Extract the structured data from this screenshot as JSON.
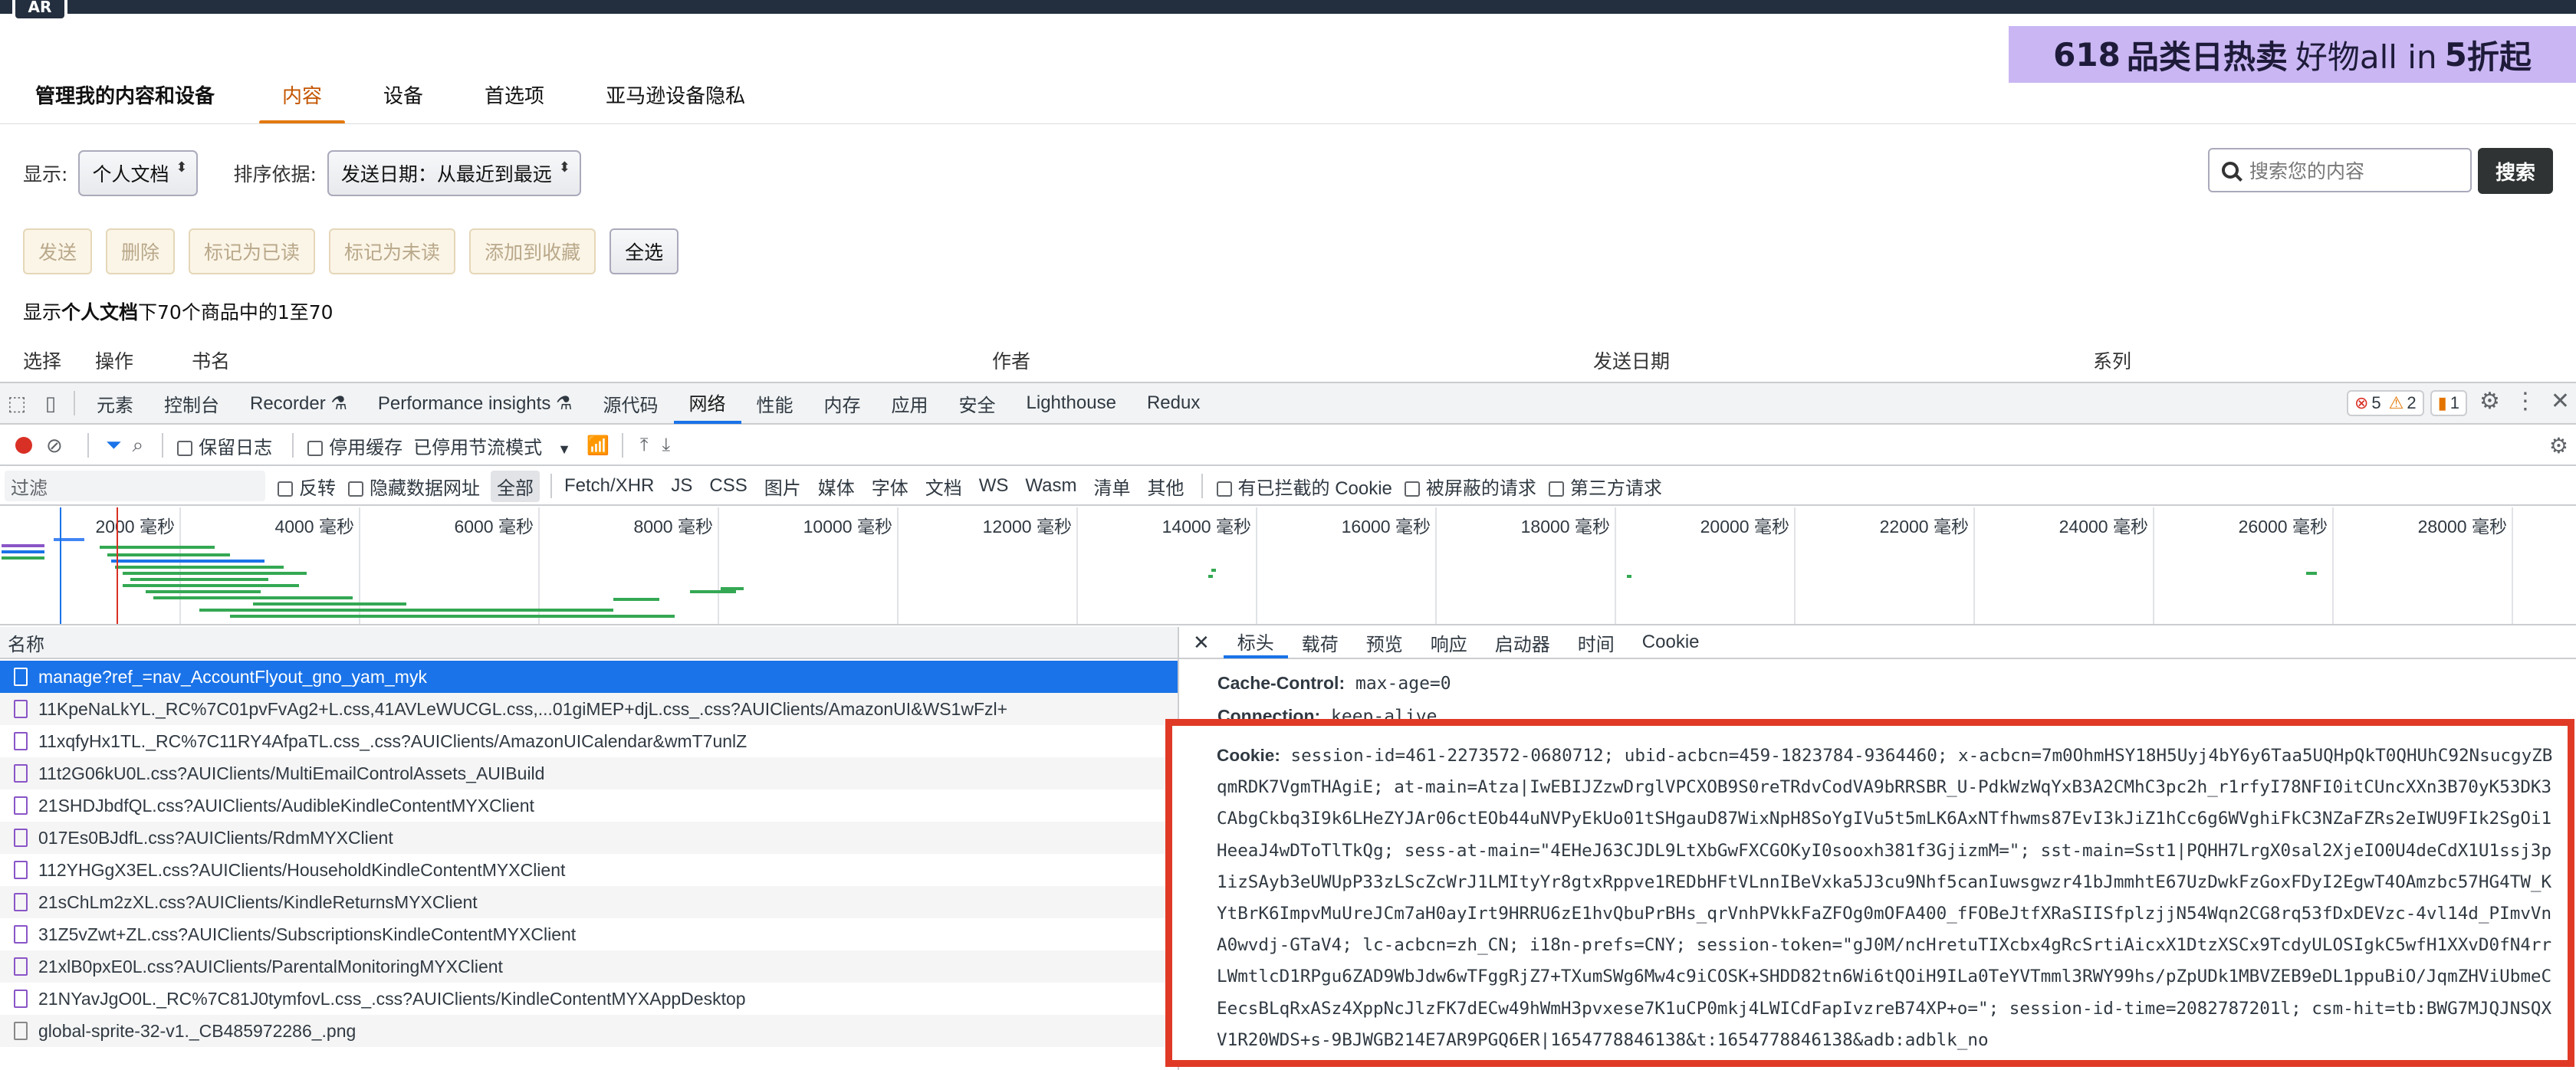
{
  "page": {
    "logo_text": "AR",
    "banner": {
      "num": "618",
      "text1": "品类日热卖",
      "text2": "好物all in",
      "num2": "5",
      "text3": "折起"
    },
    "title": "管理我的内容和设备",
    "tabs": [
      "内容",
      "设备",
      "首选项",
      "亚马逊设备隐私"
    ],
    "filter": {
      "show_label": "显示:",
      "show_value": "个人文档",
      "sort_label": "排序依据:",
      "sort_value": "发送日期：从最近到最远"
    },
    "search": {
      "placeholder": "搜索您的内容",
      "button": "搜索"
    },
    "actions": [
      "发送",
      "删除",
      "标记为已读",
      "标记为未读",
      "添加到收藏",
      "全选"
    ],
    "count": {
      "pre": "显示",
      "bold": "个人文档",
      "post": "下70个商品中的1至70"
    },
    "columns": [
      "选择",
      "操作",
      "书名",
      "作者",
      "发送日期",
      "系列"
    ]
  },
  "devtools": {
    "tabs": [
      "元素",
      "控制台",
      "Recorder ⚗",
      "Performance insights ⚗",
      "源代码",
      "网络",
      "性能",
      "内存",
      "应用",
      "安全",
      "Lighthouse",
      "Redux"
    ],
    "badges": {
      "errors": "5",
      "warnings": "2",
      "issues": "1"
    },
    "toolbar": {
      "preserve_log": "保留日志",
      "disable_cache": "停用缓存",
      "throttle": "已停用节流模式"
    },
    "filter_bar": {
      "placeholder": "过滤",
      "invert": "反转",
      "hide_data": "隐藏数据网址",
      "types": [
        "全部",
        "Fetch/XHR",
        "JS",
        "CSS",
        "图片",
        "媒体",
        "字体",
        "文档",
        "WS",
        "Wasm",
        "清单",
        "其他"
      ],
      "blocked_cookies": "有已拦截的 Cookie",
      "blocked_requests": "被屏蔽的请求",
      "third_party": "第三方请求"
    },
    "timeline_ticks": [
      "2000 毫秒",
      "4000 毫秒",
      "6000 毫秒",
      "8000 毫秒",
      "10000 毫秒",
      "12000 毫秒",
      "14000 毫秒",
      "16000 毫秒",
      "18000 毫秒",
      "20000 毫秒",
      "22000 毫秒",
      "24000 毫秒",
      "26000 毫秒",
      "28000 毫秒"
    ],
    "name_header": "名称",
    "requests": [
      "manage?ref_=nav_AccountFlyout_gno_yam_myk",
      "11KpeNaLkYL._RC%7C01pvFvAg2+L.css,41AVLeWUCGL.css,...01giMEP+djL.css_.css?AUIClients/AmazonUI&WS1wFzl+",
      "11xqfyHx1TL._RC%7C11RY4AfpaTL.css_.css?AUIClients/AmazonUICalendar&wmT7unlZ",
      "11t2G06kU0L.css?AUIClients/MultiEmailControlAssets_AUIBuild",
      "21SHDJbdfQL.css?AUIClients/AudibleKindleContentMYXClient",
      "017Es0BJdfL.css?AUIClients/RdmMYXClient",
      "112YHGgX3EL.css?AUIClients/HouseholdKindleContentMYXClient",
      "21sChLm2zXL.css?AUIClients/KindleReturnsMYXClient",
      "31Z5vZwt+ZL.css?AUIClients/SubscriptionsKindleContentMYXClient",
      "21xlB0pxE0L.css?AUIClients/ParentalMonitoringMYXClient",
      "21NYavJgO0L._RC%7C81J0tymfovL.css_.css?AUIClients/KindleContentMYXAppDesktop",
      "global-sprite-32-v1._CB485972286_.png"
    ],
    "detail_tabs": [
      "标头",
      "载荷",
      "预览",
      "响应",
      "启动器",
      "时间",
      "Cookie"
    ],
    "headers": [
      {
        "key": "Cache-Control:",
        "value": "max-age=0"
      },
      {
        "key": "Connection:",
        "value": "keep-alive"
      }
    ],
    "cookie": {
      "key": "Cookie:",
      "value": "session-id=461-2273572-0680712; ubid-acbcn=459-1823784-9364460; x-acbcn=7m0OhmHSY18H5Uyj4bY6y6Taa5UQHpQkT0QHUhC92NsucgyZBqmRDK7VgmTHAgiE; at-main=Atza|IwEBIJZzwDrglVPCXOB9S0reTRdvCodVA9bRRSBR_U-PdkWzWqYxB3A2CMhC3pc2h_r1rfyI78NFI0itCUncXXn3B70yK53DK3CAbgCkbq3I9k6LHeZYJAr06ctEOb44uNVPyEkUo01tSHgauD87WixNpH8SoYgIVu5t5mLK6AxNTfhwms87EvI3kJiZ1hCc6g6WVghiFkC3NZaFZRs2eIWU9FIk2SgOi1HeeaJ4wDToTlTkQg; sess-at-main=\"4EHeJ63CJDL9LtXbGwFXCGOKyI0sooxh381f3GjizmM=\"; sst-main=Sst1|PQHH7LrgX0sal2XjeIO0U4deCdX1U1ssj3p1izSAyb3eUWUpP33zLScZcWrJ1LMItyYr8gtxRppve1REDbHFtVLnnIBeVxka5J3cu9Nhf5canIuwsgwzr41bJmmhtE67UzDwkFzGoxFDyI2EgwT4OAmzbc57HG4TW_KYtBrK6ImpvMuUreJCm7aH0ayIrt9HRRU6zE1hvQbuPrBHs_qrVnhPVkkFaZFOg0mOFA400_fFOBeJtfXRaSIISfplzjjN54Wqn2CG8rq53fDxDEVzc-4vl14d_PImvVnA0wvdj-GTaV4; lc-acbcn=zh_CN; i18n-prefs=CNY; session-token=\"gJ0M/ncHretuTIXcbx4gRcSrtiAicxX1DtzXSCx9TcdyULOSIgkC5wfH1XXvD0fN4rrLWmtlcD1RPgu6ZAD9WbJdw6wTFggRjZ7+TXumSWg6Mw4c9iCOSK+SHDD82tn6Wi6tQOiH9ILa0TeYVTmml3RWY99hs/pZpUDk1MBVZEB9eDL1ppuBiO/JqmZHViUbmeCEecsBLqRxASz4XppNcJlzFK7dECw49hWmH3pvxese7K1uCP0mkj4LWICdFapIvzreB74XP+o=\"; session-id-time=2082787201l; csm-hit=tb:BWG7MJQJNSQXV1R20WDS+s-9BJWGB214E7AR9PGQ6ER|1654778846138&t:1654778846138&adb:adblk_no"
    }
  }
}
